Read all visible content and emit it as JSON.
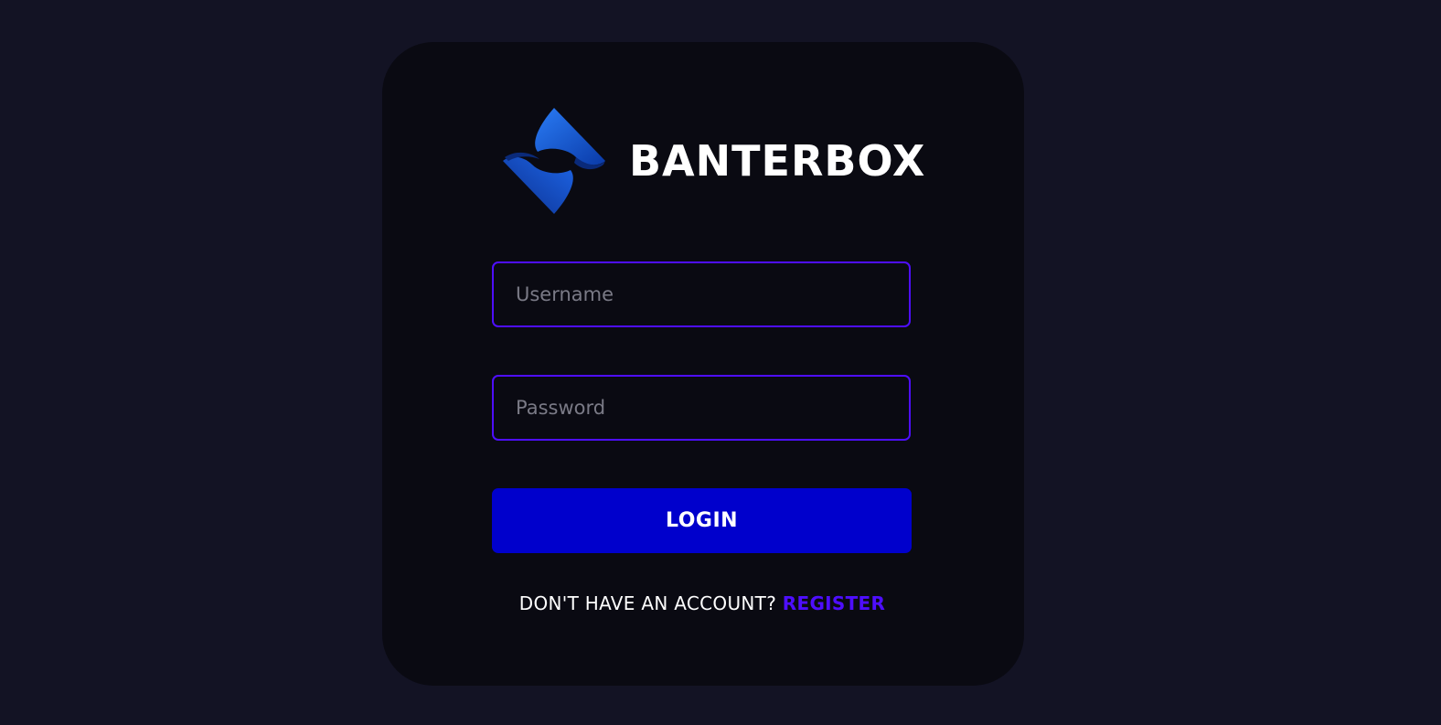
{
  "brand": {
    "name": "BANTERBOX",
    "logo_icon": "banterbox-logo-icon",
    "logo_colors": [
      "#1b6ff0",
      "#0a3fb3",
      "#0a2a7a"
    ]
  },
  "form": {
    "username_placeholder": "Username",
    "username_value": "",
    "password_placeholder": "Password",
    "password_value": "",
    "login_label": "LOGIN",
    "register_prompt": "DON'T HAVE AN ACCOUNT?",
    "register_link": "REGISTER"
  },
  "colors": {
    "background": "#131324",
    "card": "#0a0a12",
    "accent": "#4e0eff",
    "button": "#0000cc",
    "text": "#ffffff",
    "placeholder": "#7a7a86"
  }
}
